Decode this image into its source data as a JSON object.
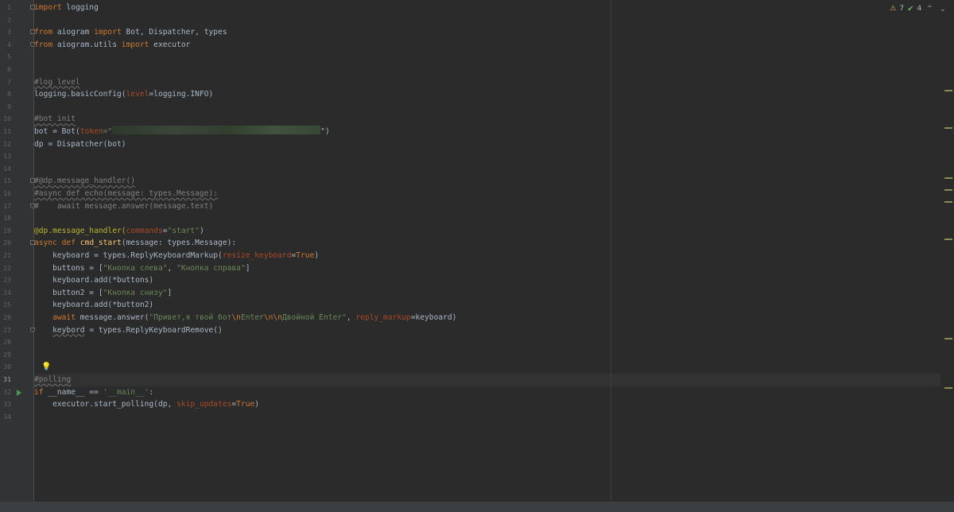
{
  "inspection": {
    "warnings": "7",
    "weak_warnings": "4"
  },
  "lines": [
    {
      "n": "1",
      "tokens": [
        {
          "t": "import",
          "c": "kw"
        },
        {
          "t": " logging",
          "c": ""
        }
      ],
      "fold": "start"
    },
    {
      "n": "2",
      "tokens": []
    },
    {
      "n": "3",
      "tokens": [
        {
          "t": "from",
          "c": "kw"
        },
        {
          "t": " aiogram ",
          "c": ""
        },
        {
          "t": "import",
          "c": "kw"
        },
        {
          "t": " Bot, Dispatcher, types",
          "c": ""
        }
      ],
      "fold": "start"
    },
    {
      "n": "4",
      "tokens": [
        {
          "t": "from",
          "c": "kw"
        },
        {
          "t": " aiogram.utils ",
          "c": ""
        },
        {
          "t": "import",
          "c": "kw"
        },
        {
          "t": " executor",
          "c": ""
        }
      ],
      "fold": "end"
    },
    {
      "n": "5",
      "tokens": []
    },
    {
      "n": "6",
      "tokens": []
    },
    {
      "n": "7",
      "tokens": [
        {
          "t": "#log level",
          "c": "cmt warn"
        }
      ]
    },
    {
      "n": "8",
      "tokens": [
        {
          "t": "logging.basicConfig(",
          "c": ""
        },
        {
          "t": "level",
          "c": "param"
        },
        {
          "t": "=logging.INFO)",
          "c": ""
        }
      ]
    },
    {
      "n": "9",
      "tokens": []
    },
    {
      "n": "10",
      "tokens": [
        {
          "t": "#bot init",
          "c": "cmt warn"
        }
      ]
    },
    {
      "n": "11",
      "tokens": [
        {
          "t": "bot = Bot(",
          "c": ""
        },
        {
          "t": "token",
          "c": "param"
        },
        {
          "t": "=\"",
          "c": "str"
        },
        {
          "t": "",
          "c": "blur"
        },
        {
          "t": "\")",
          "c": ""
        }
      ]
    },
    {
      "n": "12",
      "tokens": [
        {
          "t": "dp = Dispatcher(bot)",
          "c": ""
        }
      ]
    },
    {
      "n": "13",
      "tokens": []
    },
    {
      "n": "14",
      "tokens": []
    },
    {
      "n": "15",
      "tokens": [
        {
          "t": "#@dp.message_handler()",
          "c": "cmt warn"
        }
      ],
      "fold": "start"
    },
    {
      "n": "16",
      "tokens": [
        {
          "t": "#async def echo(message: types.Message):",
          "c": "cmt warn"
        }
      ]
    },
    {
      "n": "17",
      "tokens": [
        {
          "t": "#    await message.answer(message.text)",
          "c": "cmt"
        }
      ],
      "fold": "end"
    },
    {
      "n": "18",
      "tokens": []
    },
    {
      "n": "19",
      "tokens": [
        {
          "t": "@dp.message_handler(",
          "c": "dec"
        },
        {
          "t": "commands",
          "c": "param"
        },
        {
          "t": "=",
          "c": ""
        },
        {
          "t": "\"start\"",
          "c": "str"
        },
        {
          "t": ")",
          "c": ""
        }
      ]
    },
    {
      "n": "20",
      "tokens": [
        {
          "t": "async def ",
          "c": "kw"
        },
        {
          "t": "cmd_start",
          "c": "fn"
        },
        {
          "t": "(message: types.Message):",
          "c": ""
        }
      ],
      "fold": "start"
    },
    {
      "n": "21",
      "tokens": [
        {
          "t": "    keyboard = types.ReplyKeyboardMarkup(",
          "c": ""
        },
        {
          "t": "resize_keyboard",
          "c": "param"
        },
        {
          "t": "=",
          "c": ""
        },
        {
          "t": "True",
          "c": "kw"
        },
        {
          "t": ")",
          "c": ""
        }
      ]
    },
    {
      "n": "22",
      "tokens": [
        {
          "t": "    buttons = [",
          "c": ""
        },
        {
          "t": "\"Кнопка слева\"",
          "c": "str"
        },
        {
          "t": ", ",
          "c": ""
        },
        {
          "t": "\"Кнопка справа\"",
          "c": "str"
        },
        {
          "t": "]",
          "c": ""
        }
      ]
    },
    {
      "n": "23",
      "tokens": [
        {
          "t": "    keyboard.add(*buttons)",
          "c": ""
        }
      ]
    },
    {
      "n": "24",
      "tokens": [
        {
          "t": "    button2 = [",
          "c": ""
        },
        {
          "t": "\"Кнопка снизу\"",
          "c": "str"
        },
        {
          "t": "]",
          "c": ""
        }
      ]
    },
    {
      "n": "25",
      "tokens": [
        {
          "t": "    keyboard.add(*button2)",
          "c": ""
        }
      ]
    },
    {
      "n": "26",
      "tokens": [
        {
          "t": "    ",
          "c": ""
        },
        {
          "t": "await",
          "c": "kw"
        },
        {
          "t": " message.answer(",
          "c": ""
        },
        {
          "t": "\"Привет,я твой бот",
          "c": "str"
        },
        {
          "t": "\\n",
          "c": "esc"
        },
        {
          "t": "Enter",
          "c": "str"
        },
        {
          "t": "\\n\\n",
          "c": "esc"
        },
        {
          "t": "Двойной Enter\"",
          "c": "str"
        },
        {
          "t": ", ",
          "c": ""
        },
        {
          "t": "reply_markup",
          "c": "param"
        },
        {
          "t": "=keyboard)",
          "c": ""
        }
      ]
    },
    {
      "n": "27",
      "tokens": [
        {
          "t": "    ",
          "c": ""
        },
        {
          "t": "keybord",
          "c": "warn"
        },
        {
          "t": " = types.ReplyKeyboardRemove()",
          "c": ""
        }
      ],
      "fold": "end"
    },
    {
      "n": "28",
      "tokens": []
    },
    {
      "n": "29",
      "tokens": []
    },
    {
      "n": "30",
      "tokens": [],
      "bulb": "💡"
    },
    {
      "n": "31",
      "tokens": [
        {
          "t": "#polling",
          "c": "cmt warn"
        }
      ],
      "current": true
    },
    {
      "n": "32",
      "tokens": [
        {
          "t": "if",
          "c": "kw"
        },
        {
          "t": " __name__ == ",
          "c": ""
        },
        {
          "t": "'__main__'",
          "c": "str"
        },
        {
          "t": ":",
          "c": ""
        }
      ],
      "run": true
    },
    {
      "n": "33",
      "tokens": [
        {
          "t": "    executor.start_polling(dp, ",
          "c": ""
        },
        {
          "t": "skip_updates",
          "c": "param"
        },
        {
          "t": "=",
          "c": ""
        },
        {
          "t": "True",
          "c": "kw"
        },
        {
          "t": ")",
          "c": ""
        }
      ]
    },
    {
      "n": "34",
      "tokens": []
    }
  ]
}
